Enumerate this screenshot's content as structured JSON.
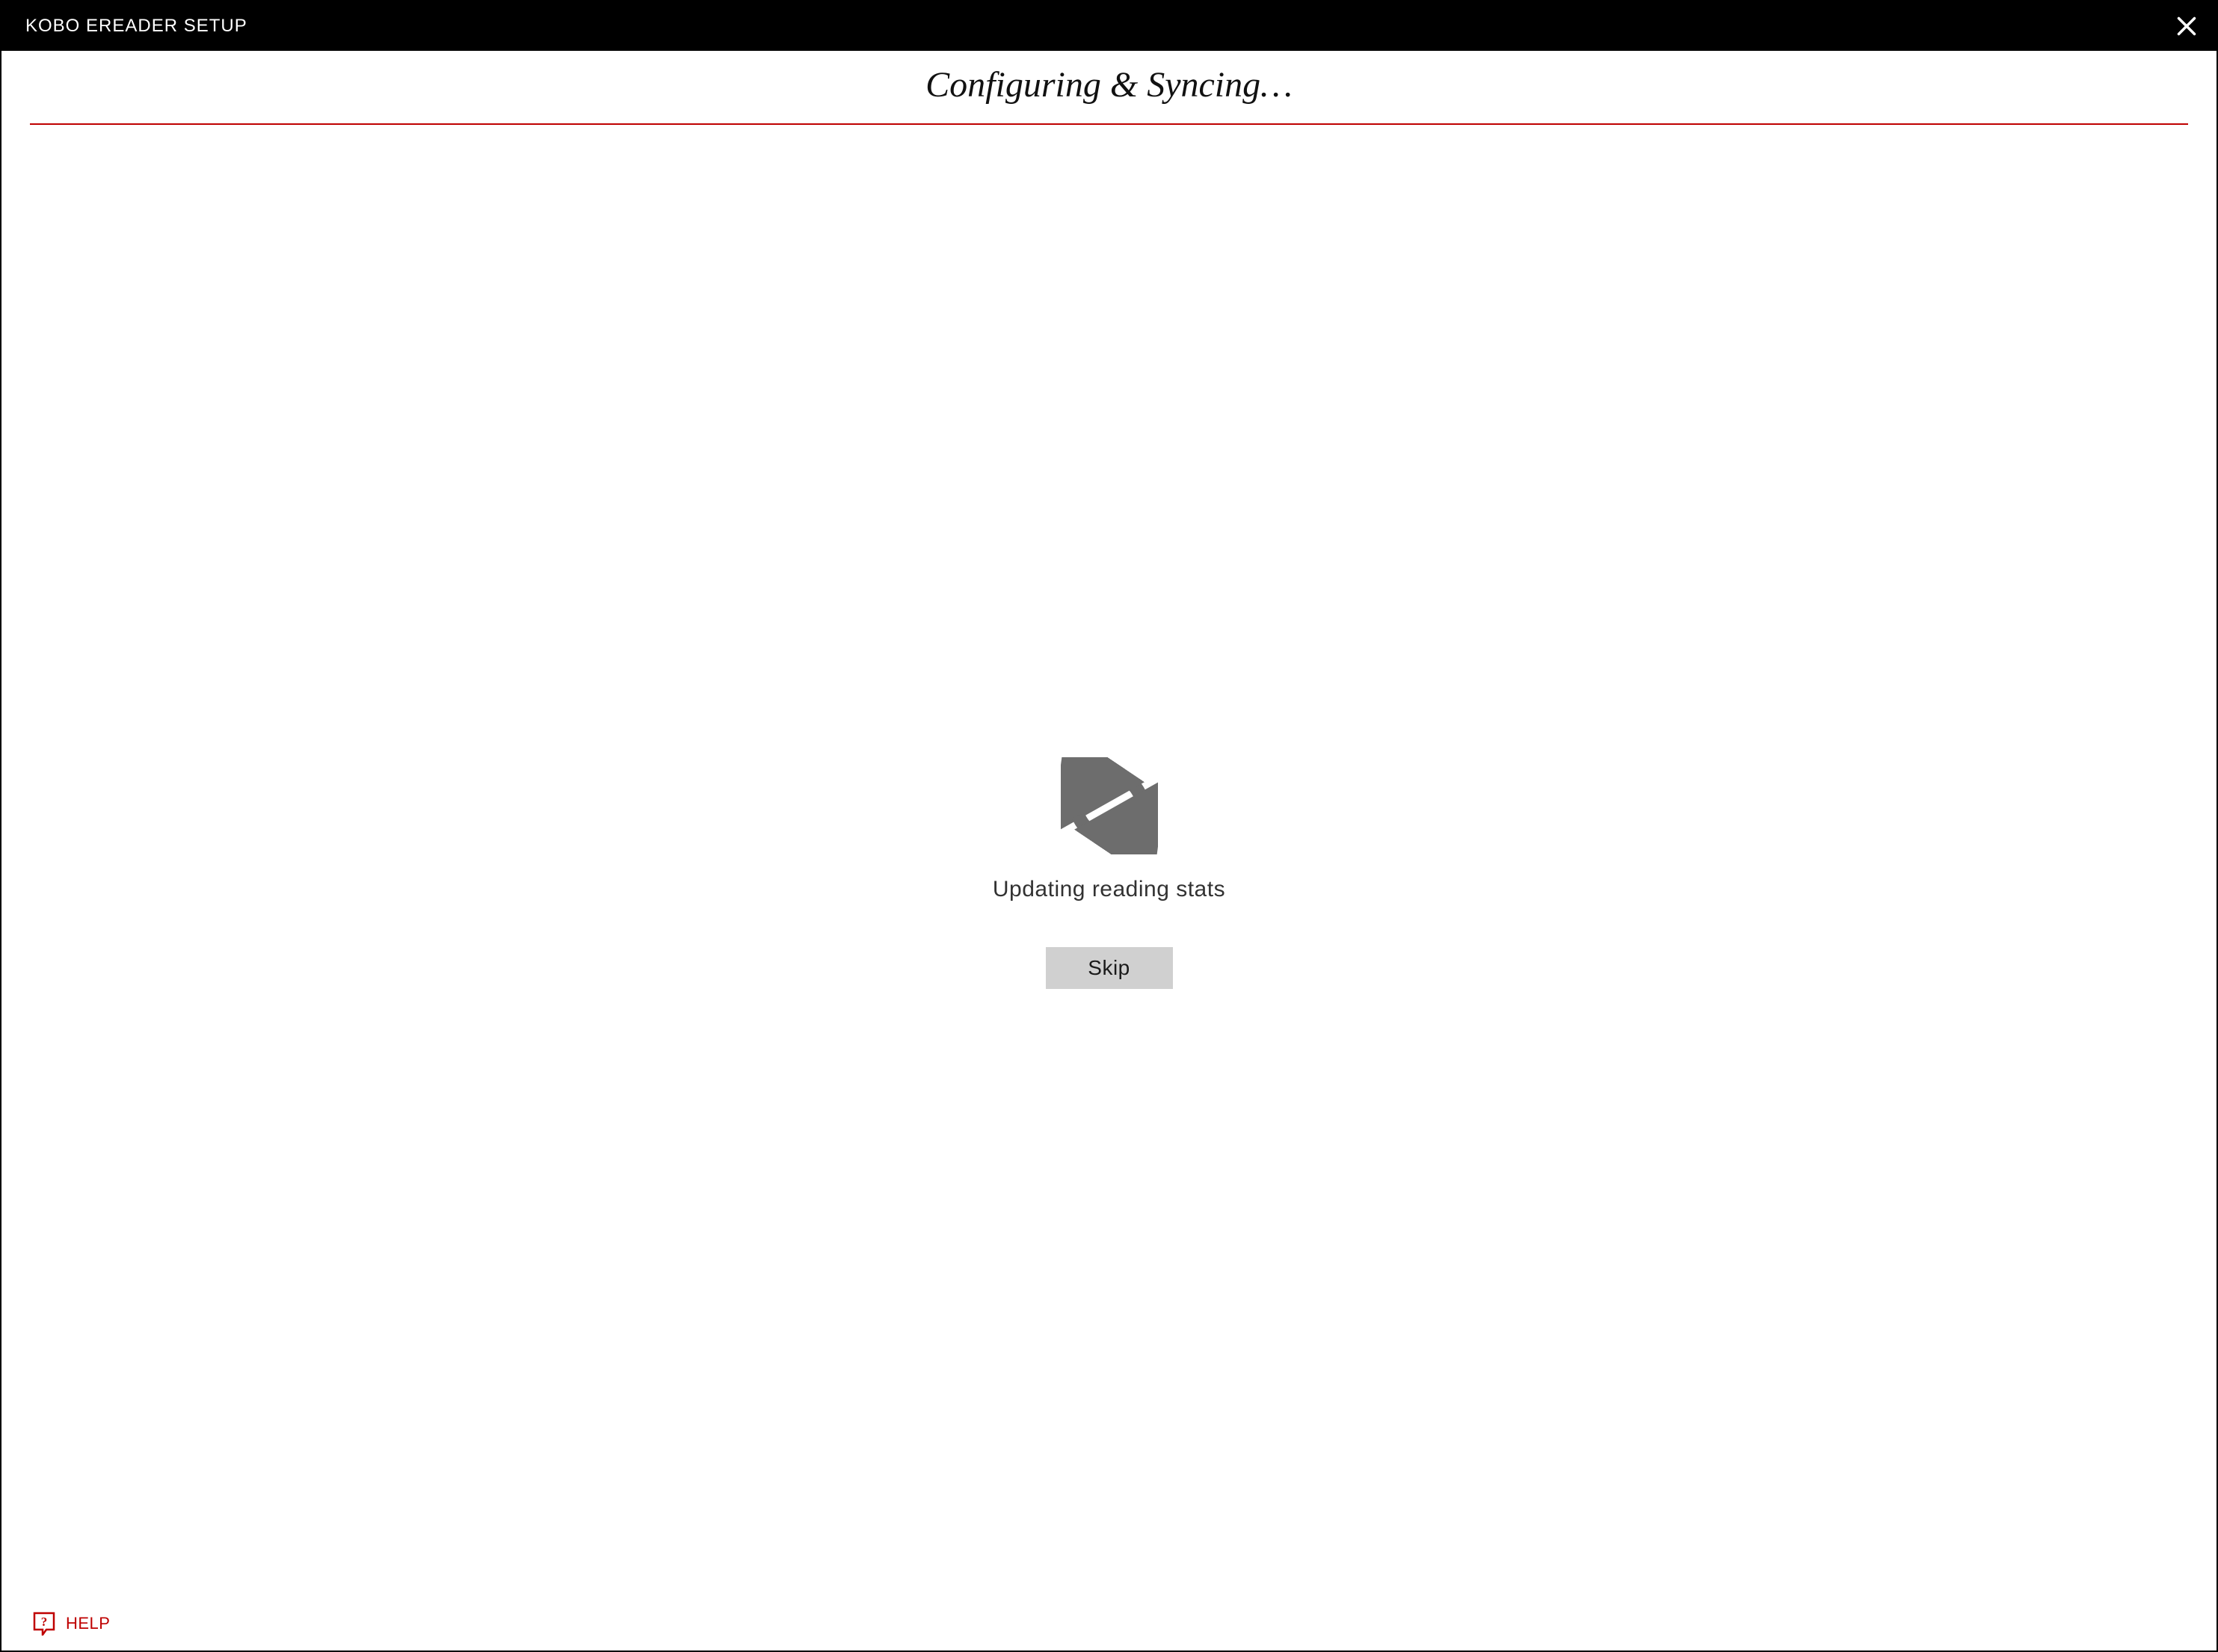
{
  "titlebar": {
    "title": "KOBO EREADER SETUP"
  },
  "heading": "Configuring & Syncing…",
  "status": "Updating reading stats",
  "buttons": {
    "skip": "Skip"
  },
  "footer": {
    "help_label": "HELP"
  },
  "colors": {
    "accent": "#bf0000",
    "icon_gray": "#6d6d6d",
    "button_bg": "#d0d0d0"
  }
}
